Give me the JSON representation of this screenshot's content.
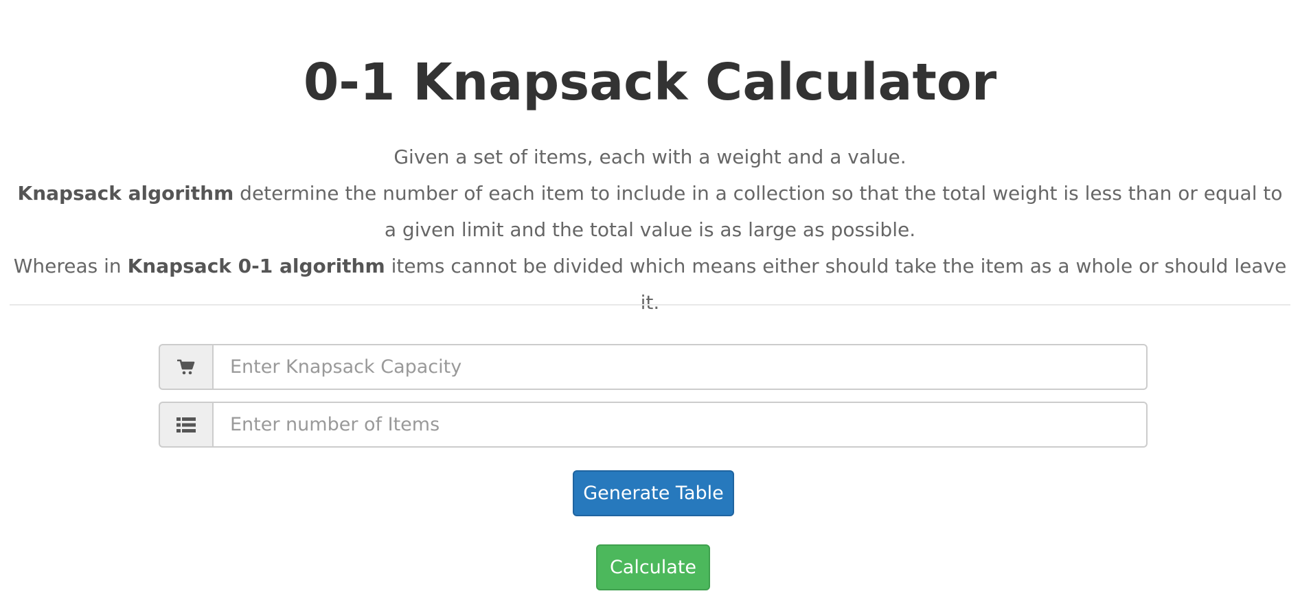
{
  "header": {
    "title": "0-1 Knapsack Calculator"
  },
  "description": {
    "line1": "Given a set of items, each with a weight and a value.",
    "line2_bold": "Knapsack algorithm",
    "line2_rest": " determine the number of each item to include in a collection so that the total weight is less than or equal to a given limit and the total value is as large as possible.",
    "line3_start": "Whereas in ",
    "line3_bold": "Knapsack 0-1 algorithm",
    "line3_rest": " items cannot be divided which means either should take the item as a whole or should leave it."
  },
  "form": {
    "capacity": {
      "icon": "shopping-cart-icon",
      "placeholder": "Enter Knapsack Capacity",
      "value": ""
    },
    "items": {
      "icon": "list-icon",
      "placeholder": "Enter number of Items",
      "value": ""
    }
  },
  "actions": {
    "generate_label": "Generate Table",
    "calculate_label": "Calculate"
  },
  "colors": {
    "primary_button": "#2779bd",
    "success_button": "#4cb85c",
    "title_text": "#333333",
    "body_text": "#666666"
  }
}
